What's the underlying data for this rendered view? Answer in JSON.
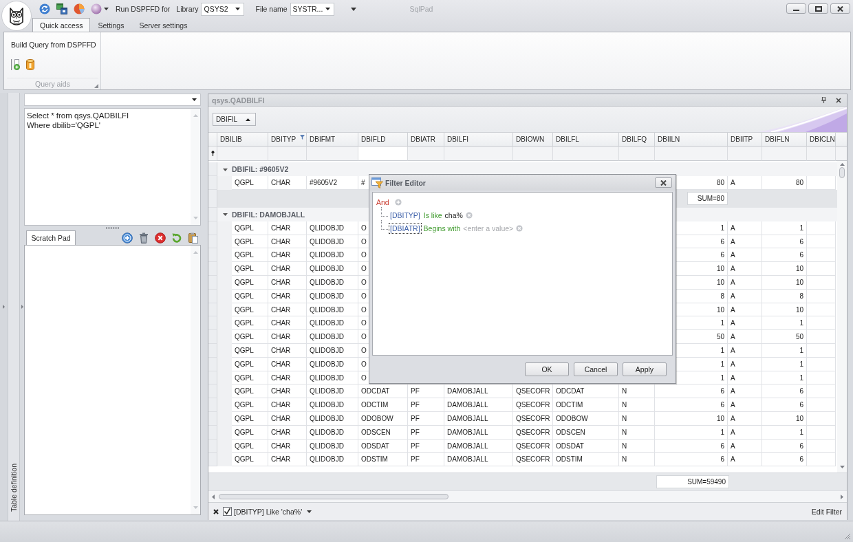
{
  "window": {
    "title": "SqlPad"
  },
  "quick_access": {
    "run_label": "Run DSPFFD for",
    "library": {
      "label": "Library",
      "value": "QSYS2"
    },
    "file_name": {
      "label": "File name",
      "value": "SYSTR..."
    }
  },
  "ribbon": {
    "tabs": [
      {
        "label": "Quick access",
        "selected": true
      },
      {
        "label": "Settings",
        "selected": false
      },
      {
        "label": "Server settings",
        "selected": false
      }
    ],
    "group": {
      "title": "Build Query from DSPFFD",
      "caption": "Query aids"
    }
  },
  "side_panel": {
    "tab": "Table definition"
  },
  "query_editor": {
    "lines": [
      "Select * from qsys.QADBILFI",
      "Where dbilib='QGPL'"
    ]
  },
  "scratch_pad": {
    "tabs": [
      {
        "label": "Scratch Pad",
        "selected": true
      }
    ]
  },
  "grid": {
    "title": "qsys.QADBILFI",
    "group_by": [
      {
        "label": "DBIFIL",
        "ascending": true
      }
    ],
    "columns": [
      {
        "label": "DBILIB",
        "filtered": false,
        "filter_focused": false
      },
      {
        "label": "DBITYP",
        "filtered": true,
        "filter_focused": false
      },
      {
        "label": "DBIFMT",
        "filtered": false,
        "filter_focused": false
      },
      {
        "label": "DBIFLD",
        "filtered": false,
        "filter_focused": true
      },
      {
        "label": "DBIATR",
        "filtered": false,
        "filter_focused": false
      },
      {
        "label": "DBILFI",
        "filtered": false,
        "filter_focused": false
      },
      {
        "label": "DBIOWN",
        "filtered": false,
        "filter_focused": false
      },
      {
        "label": "DBILFL",
        "filtered": false,
        "filter_focused": false
      },
      {
        "label": "DBILFQ",
        "filtered": false,
        "filter_focused": false
      },
      {
        "label": "DBIILN",
        "filtered": false,
        "filter_focused": false
      },
      {
        "label": "DBIITP",
        "filtered": false,
        "filter_focused": false
      },
      {
        "label": "DBIFLN",
        "filtered": false,
        "filter_focused": false
      },
      {
        "label": "DBICLN",
        "filtered": false,
        "filter_focused": false
      }
    ],
    "groups": [
      {
        "label": "DBIFIL: #9605V2",
        "expanded": true,
        "rows": [
          [
            "QGPL",
            "CHAR",
            "#9605V2",
            "#",
            null,
            null,
            null,
            null,
            null,
            "80",
            "A",
            "80"
          ]
        ],
        "summary": "SUM=80"
      },
      {
        "label": "DBIFIL: DAMOBJALL",
        "expanded": true,
        "rows": [
          [
            "QGPL",
            "CHAR",
            "QLIDOBJD",
            "O",
            null,
            null,
            null,
            null,
            null,
            "1",
            "A",
            "1"
          ],
          [
            "QGPL",
            "CHAR",
            "QLIDOBJD",
            "O",
            null,
            null,
            null,
            null,
            null,
            "6",
            "A",
            "6"
          ],
          [
            "QGPL",
            "CHAR",
            "QLIDOBJD",
            "O",
            null,
            null,
            null,
            null,
            null,
            "6",
            "A",
            "6"
          ],
          [
            "QGPL",
            "CHAR",
            "QLIDOBJD",
            "O",
            null,
            null,
            null,
            null,
            null,
            "10",
            "A",
            "10"
          ],
          [
            "QGPL",
            "CHAR",
            "QLIDOBJD",
            "O",
            null,
            null,
            null,
            null,
            null,
            "10",
            "A",
            "10"
          ],
          [
            "QGPL",
            "CHAR",
            "QLIDOBJD",
            "O",
            null,
            null,
            null,
            null,
            null,
            "8",
            "A",
            "8"
          ],
          [
            "QGPL",
            "CHAR",
            "QLIDOBJD",
            "O",
            null,
            null,
            null,
            null,
            null,
            "10",
            "A",
            "10"
          ],
          [
            "QGPL",
            "CHAR",
            "QLIDOBJD",
            "O",
            null,
            null,
            null,
            null,
            null,
            "1",
            "A",
            "1"
          ],
          [
            "QGPL",
            "CHAR",
            "QLIDOBJD",
            "O",
            null,
            null,
            null,
            null,
            null,
            "50",
            "A",
            "50"
          ],
          [
            "QGPL",
            "CHAR",
            "QLIDOBJD",
            "O",
            null,
            null,
            null,
            null,
            null,
            "1",
            "A",
            "1"
          ],
          [
            "QGPL",
            "CHAR",
            "QLIDOBJD",
            "O",
            null,
            null,
            null,
            null,
            null,
            "1",
            "A",
            "1"
          ],
          [
            "QGPL",
            "CHAR",
            "QLIDOBJD",
            "O",
            null,
            null,
            null,
            null,
            null,
            "1",
            "A",
            "1"
          ],
          [
            "QGPL",
            "CHAR",
            "QLIDOBJD",
            "ODCDAT",
            "PF",
            "DAMOBJALL",
            "QSECOFR",
            "ODCDAT",
            "N",
            "6",
            "A",
            "6"
          ],
          [
            "QGPL",
            "CHAR",
            "QLIDOBJD",
            "ODCTIM",
            "PF",
            "DAMOBJALL",
            "QSECOFR",
            "ODCTIM",
            "N",
            "6",
            "A",
            "6"
          ],
          [
            "QGPL",
            "CHAR",
            "QLIDOBJD",
            "ODOBOW",
            "PF",
            "DAMOBJALL",
            "QSECOFR",
            "ODOBOW",
            "N",
            "10",
            "A",
            "10"
          ],
          [
            "QGPL",
            "CHAR",
            "QLIDOBJD",
            "ODSCEN",
            "PF",
            "DAMOBJALL",
            "QSECOFR",
            "ODSCEN",
            "N",
            "1",
            "A",
            "1"
          ],
          [
            "QGPL",
            "CHAR",
            "QLIDOBJD",
            "ODSDAT",
            "PF",
            "DAMOBJALL",
            "QSECOFR",
            "ODSDAT",
            "N",
            "6",
            "A",
            "6"
          ],
          [
            "QGPL",
            "CHAR",
            "QLIDOBJD",
            "ODSTIM",
            "PF",
            "DAMOBJALL",
            "QSECOFR",
            "ODSTIM",
            "N",
            "6",
            "A",
            "6"
          ]
        ]
      }
    ],
    "total_summary": "SUM=59490",
    "filter": {
      "enabled": true,
      "text": "[DBITYP] Like 'cha%'",
      "edit_label": "Edit Filter"
    }
  },
  "filter_editor": {
    "title": "Filter Editor",
    "root": {
      "operator": "And",
      "children": [
        {
          "field": "[DBITYP]",
          "operation": "Is like",
          "value": "cha%",
          "focused": false
        },
        {
          "field": "[DBIATR]",
          "operation": "Begins with",
          "placeholder": "<enter a value>",
          "focused": true
        }
      ]
    },
    "buttons": [
      {
        "label": "OK"
      },
      {
        "label": "Cancel"
      },
      {
        "label": "Apply"
      }
    ]
  }
}
